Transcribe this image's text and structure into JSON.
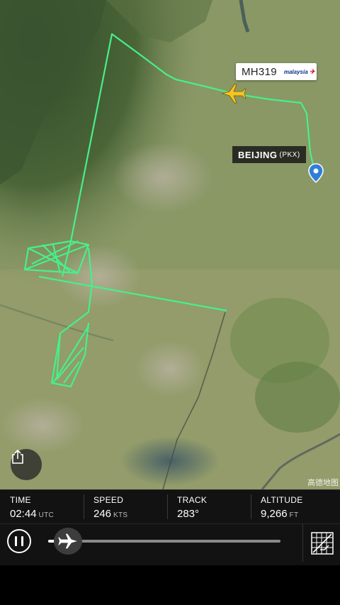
{
  "map": {
    "flight_number": "MH319",
    "airline_logo_text": "malaysia",
    "airport_name": "BEIJING",
    "airport_code": "(PKX)",
    "watermark": "高德地图",
    "track_color": "#46f08a",
    "plane_color": "#f3c623"
  },
  "stats": {
    "time": {
      "label": "TIME",
      "value": "02:44",
      "unit": "UTC"
    },
    "speed": {
      "label": "SPEED",
      "value": "246",
      "unit": "KTS"
    },
    "track": {
      "label": "TRACK",
      "value": "283°",
      "unit": ""
    },
    "altitude": {
      "label": "ALTITUDE",
      "value": "9,266",
      "unit": "FT"
    }
  },
  "playback": {
    "progress": 0.03,
    "pause_icon": "pause-icon",
    "thumb_icon": "airplane-icon"
  },
  "buttons": {
    "share_icon": "share-icon",
    "map_view_icon": "map-view-icon"
  }
}
